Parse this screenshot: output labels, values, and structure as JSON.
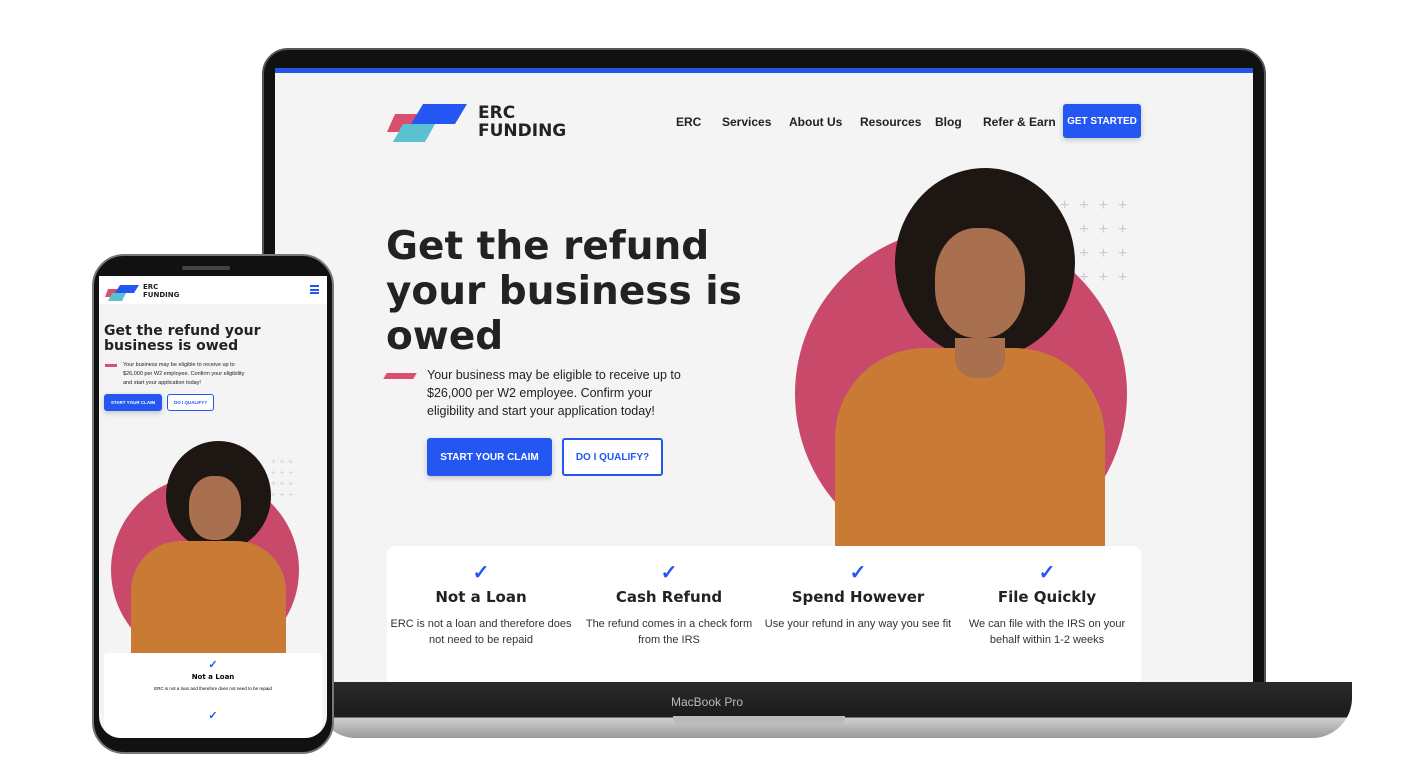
{
  "device_label": "MacBook Pro",
  "brand": {
    "line1": "ERC",
    "line2": "FUNDING",
    "colors": {
      "blue": "#2456f2",
      "pink": "#d9506f",
      "teal": "#5bc0d0"
    }
  },
  "nav": {
    "items": [
      "ERC",
      "Services",
      "About Us",
      "Resources",
      "Blog",
      "Refer & Earn"
    ],
    "cta": "GET STARTED",
    "menu_icon": "hamburger-icon"
  },
  "hero": {
    "title": "Get the refund your business is owed",
    "title_lines": [
      "Get the refund",
      "your business is",
      "owed"
    ],
    "text": "Your business may be eligible to receive up to $26,000 per W2 employee. Confirm your eligibility and start your application today!",
    "primary": "START YOUR CLAIM",
    "secondary": "DO I QUALIFY?"
  },
  "features": [
    {
      "title": "Not a Loan",
      "text": "ERC is not a loan and therefore does not need to be repaid"
    },
    {
      "title": "Cash Refund",
      "text": "The refund comes in a check form from the IRS"
    },
    {
      "title": "Spend However",
      "text": "Use your refund in any way you see fit"
    },
    {
      "title": "File Quickly",
      "text": "We can file with the IRS on your behalf within 1-2 weeks"
    }
  ],
  "check_icon": "✓"
}
